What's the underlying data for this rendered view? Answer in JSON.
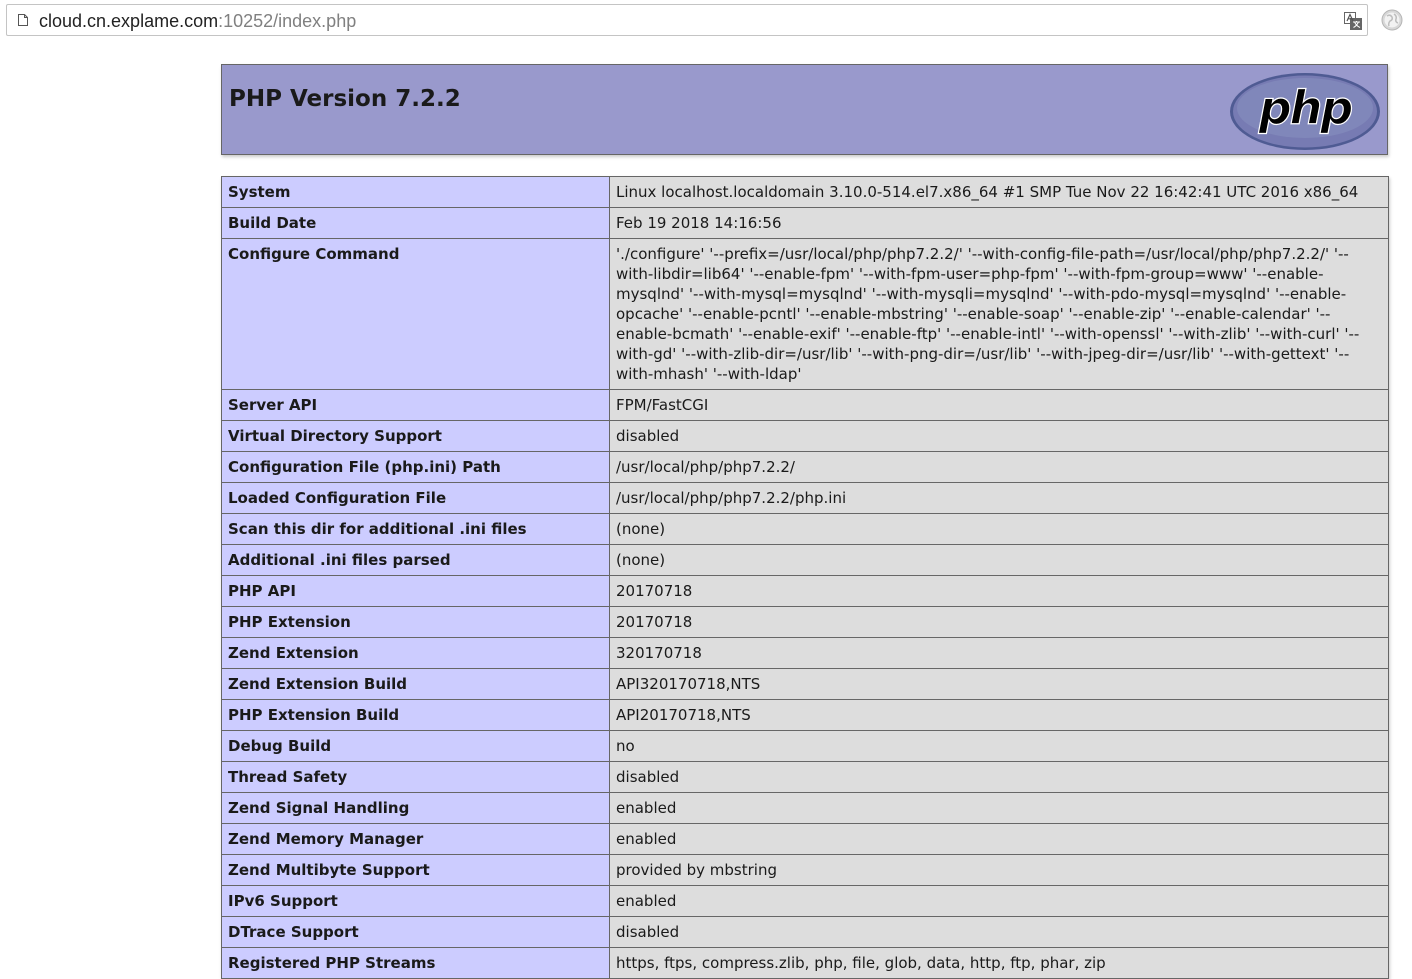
{
  "browser": {
    "url_host": "cloud.cn.explame.com",
    "url_path": ":10252/index.php"
  },
  "header": {
    "title": "PHP Version 7.2.2",
    "logo_text": "php"
  },
  "rows": [
    {
      "key": "System",
      "value": "Linux localhost.localdomain 3.10.0-514.el7.x86_64 #1 SMP Tue Nov 22 16:42:41 UTC 2016 x86_64"
    },
    {
      "key": "Build Date",
      "value": "Feb 19 2018 14:16:56"
    },
    {
      "key": "Configure Command",
      "value": "'./configure' '--prefix=/usr/local/php/php7.2.2/' '--with-config-file-path=/usr/local/php/php7.2.2/' '--with-libdir=lib64' '--enable-fpm' '--with-fpm-user=php-fpm' '--with-fpm-group=www' '--enable-mysqlnd' '--with-mysql=mysqlnd' '--with-mysqli=mysqlnd' '--with-pdo-mysql=mysqlnd' '--enable-opcache' '--enable-pcntl' '--enable-mbstring' '--enable-soap' '--enable-zip' '--enable-calendar' '--enable-bcmath' '--enable-exif' '--enable-ftp' '--enable-intl' '--with-openssl' '--with-zlib' '--with-curl' '--with-gd' '--with-zlib-dir=/usr/lib' '--with-png-dir=/usr/lib' '--with-jpeg-dir=/usr/lib' '--with-gettext' '--with-mhash' '--with-ldap'"
    },
    {
      "key": "Server API",
      "value": "FPM/FastCGI"
    },
    {
      "key": "Virtual Directory Support",
      "value": "disabled"
    },
    {
      "key": "Configuration File (php.ini) Path",
      "value": "/usr/local/php/php7.2.2/"
    },
    {
      "key": "Loaded Configuration File",
      "value": "/usr/local/php/php7.2.2/php.ini"
    },
    {
      "key": "Scan this dir for additional .ini files",
      "value": "(none)"
    },
    {
      "key": "Additional .ini files parsed",
      "value": "(none)"
    },
    {
      "key": "PHP API",
      "value": "20170718"
    },
    {
      "key": "PHP Extension",
      "value": "20170718"
    },
    {
      "key": "Zend Extension",
      "value": "320170718"
    },
    {
      "key": "Zend Extension Build",
      "value": "API320170718,NTS"
    },
    {
      "key": "PHP Extension Build",
      "value": "API20170718,NTS"
    },
    {
      "key": "Debug Build",
      "value": "no"
    },
    {
      "key": "Thread Safety",
      "value": "disabled"
    },
    {
      "key": "Zend Signal Handling",
      "value": "enabled"
    },
    {
      "key": "Zend Memory Manager",
      "value": "enabled"
    },
    {
      "key": "Zend Multibyte Support",
      "value": "provided by mbstring"
    },
    {
      "key": "IPv6 Support",
      "value": "enabled"
    },
    {
      "key": "DTrace Support",
      "value": "disabled"
    },
    {
      "key": "Registered PHP Streams",
      "value": "https, ftps, compress.zlib, php, file, glob, data, http, ftp, phar, zip"
    }
  ],
  "colors": {
    "header_bg": "#9999cc",
    "key_bg": "#ccccff",
    "value_bg": "#dddddd",
    "border": "#666666",
    "logo_bg": "#777bb3"
  }
}
